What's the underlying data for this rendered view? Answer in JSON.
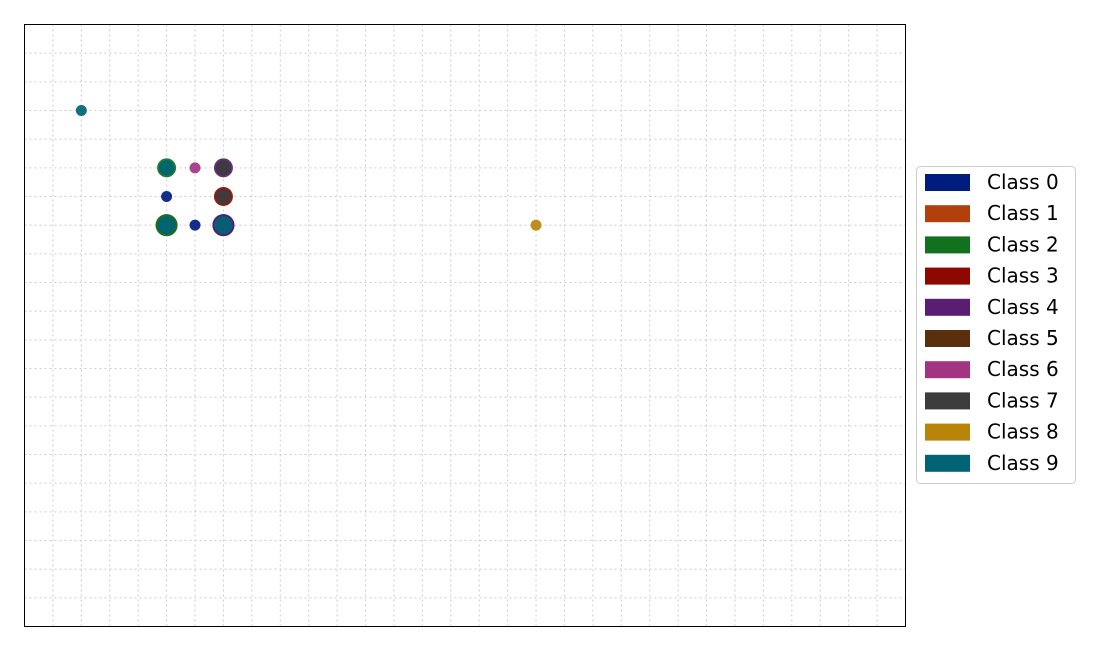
{
  "chart_data": {
    "type": "scatter",
    "title": "",
    "xlabel": "",
    "ylabel": "",
    "xlim": [
      0,
      31
    ],
    "ylim": [
      0,
      21
    ],
    "grid": true,
    "axis_ticks_visible": false,
    "legend_placement": "center-right outside",
    "legend_entries": [
      {
        "label": "Class 0",
        "color": "#001c7f"
      },
      {
        "label": "Class 1",
        "color": "#b1400d"
      },
      {
        "label": "Class 2",
        "color": "#12711c"
      },
      {
        "label": "Class 3",
        "color": "#8c0800"
      },
      {
        "label": "Class 4",
        "color": "#591e71"
      },
      {
        "label": "Class 5",
        "color": "#592f0d"
      },
      {
        "label": "Class 6",
        "color": "#a23582"
      },
      {
        "label": "Class 7",
        "color": "#3c3c3c"
      },
      {
        "label": "Class 8",
        "color": "#b8850a"
      },
      {
        "label": "Class 9",
        "color": "#006374"
      }
    ],
    "points": [
      {
        "x": 2,
        "y": 18,
        "classes": [
          9
        ]
      },
      {
        "x": 5,
        "y": 16,
        "classes": [
          2,
          9
        ]
      },
      {
        "x": 6,
        "y": 16,
        "classes": [
          6
        ]
      },
      {
        "x": 7,
        "y": 16,
        "classes": [
          4,
          7
        ]
      },
      {
        "x": 5,
        "y": 15,
        "classes": [
          0
        ]
      },
      {
        "x": 7,
        "y": 15,
        "classes": [
          3,
          7
        ]
      },
      {
        "x": 5,
        "y": 14,
        "classes": [
          1,
          2,
          9
        ]
      },
      {
        "x": 6,
        "y": 14,
        "classes": [
          0
        ]
      },
      {
        "x": 7,
        "y": 14,
        "classes": [
          0,
          4,
          9
        ]
      },
      {
        "x": 18,
        "y": 14,
        "classes": [
          8
        ]
      }
    ]
  }
}
